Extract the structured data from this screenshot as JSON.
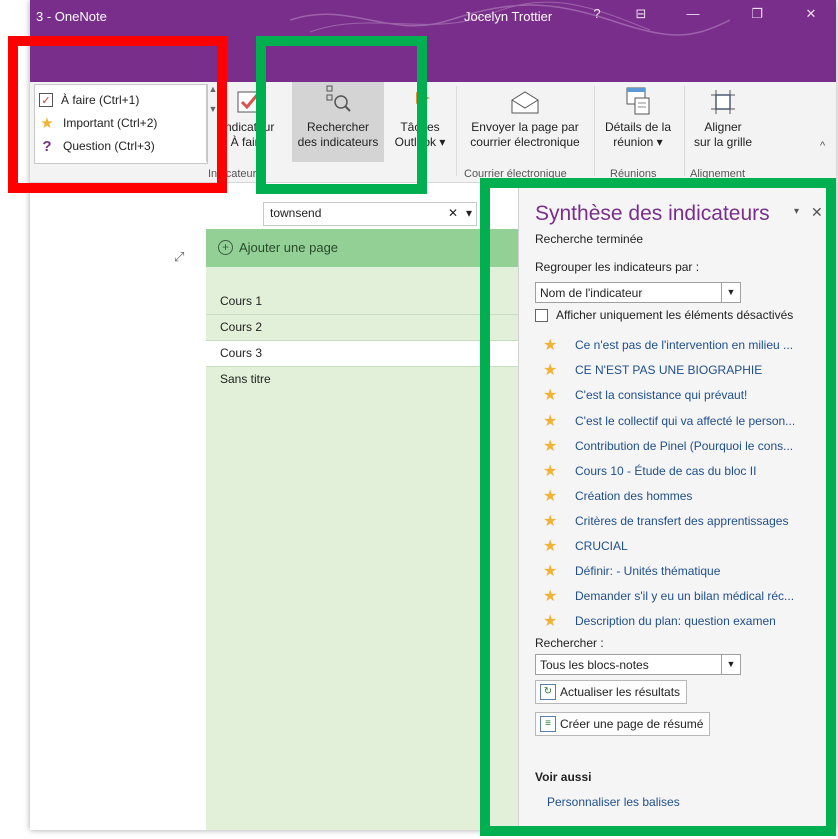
{
  "window": {
    "app_title": "3 - OneNote",
    "user_name": "Jocelyn Trottier",
    "controls": {
      "help": "?",
      "restore_ribbon": "⊟",
      "minimize": "—",
      "maximize": "❐",
      "close": "✕"
    }
  },
  "ribbon": {
    "tag_list": [
      {
        "label": "À faire (Ctrl+1)",
        "icon": "checkbox-icon"
      },
      {
        "label": "Important (Ctrl+2)",
        "icon": "star-icon"
      },
      {
        "label": "Question (Ctrl+3)",
        "icon": "question-icon"
      }
    ],
    "buttons": {
      "todo_tag": {
        "line1": "Indicateur",
        "line2": "À faire"
      },
      "find_tags": {
        "line1": "Rechercher",
        "line2": "des indicateurs"
      },
      "outlook_tasks": {
        "line1": "Tâches",
        "line2": "Outlook ▾"
      },
      "email_page": {
        "line1": "Envoyer la page par",
        "line2": "courrier électronique"
      },
      "meeting_details": {
        "line1": "Détails de la",
        "line2": "réunion ▾"
      },
      "snap_grid": {
        "line1": "Aligner",
        "line2": "sur la grille"
      }
    },
    "groups": {
      "tags": "Indicateurs",
      "email": "Courrier électronique",
      "meetings": "Réunions",
      "align": "Alignement"
    },
    "collapse": "^"
  },
  "search": {
    "value": "townsend",
    "clear": "✕",
    "dropdown": "▾"
  },
  "pages": {
    "add_page": "Ajouter une page",
    "items": [
      {
        "title": "Cours 1"
      },
      {
        "title": "Cours 2"
      },
      {
        "title": "Cours 3"
      },
      {
        "title": "Sans titre"
      }
    ]
  },
  "summary": {
    "title": "Synthèse des indicateurs",
    "pin": "▾",
    "close": "✕",
    "status": "Recherche terminée",
    "group_label": "Regrouper les indicateurs par :",
    "group_value": "Nom de l'indicateur",
    "only_unchecked": "Afficher uniquement les éléments désactivés",
    "tags": [
      "Ce n'est pas de l'intervention en milieu ...",
      "CE N'EST PAS UNE BIOGRAPHIE",
      "C'est la consistance qui prévaut!",
      "C'est le collectif qui va affecté le person...",
      "Contribution de Pinel (Pourquoi le cons...",
      "Cours 10 - Étude de cas du bloc II",
      "Création des hommes",
      "Critères de transfert des apprentissages",
      "CRUCIAL",
      "Définir: - Unités thématique",
      "Demander s'il y eu un bilan médical réc...",
      "Description du plan: question examen"
    ],
    "search_label": "Rechercher :",
    "search_scope": "Tous les blocs-notes",
    "refresh_button": "Actualiser les résultats",
    "create_summary_button": "Créer une page de résumé",
    "see_also": "Voir aussi",
    "customize_link": "Personnaliser les balises"
  },
  "colors": {
    "title_bar": "#7a2e8c",
    "add_page_bar": "#92d095",
    "page_list_bg": "#e2f0d9",
    "highlight_red": "#ff0000",
    "highlight_green": "#00b050"
  }
}
